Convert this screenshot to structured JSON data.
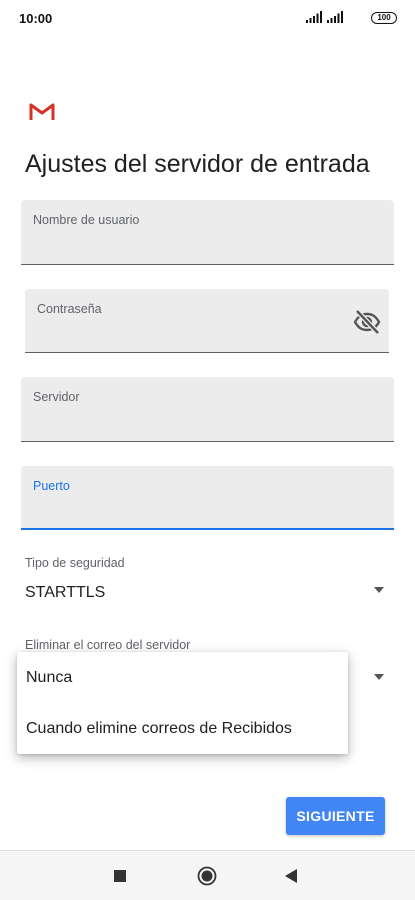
{
  "status_bar": {
    "time": "10:00",
    "battery": "100",
    "icons": [
      "signal-icon",
      "signal-icon",
      "battery-icon"
    ]
  },
  "app": {
    "logo_icon": "gmail-logo-icon",
    "brand_color": "#d93025"
  },
  "page": {
    "title": "Ajustes del servidor de entrada"
  },
  "form": {
    "username": {
      "label": "Nombre de usuario",
      "value": ""
    },
    "password": {
      "label": "Contraseña",
      "value": "",
      "toggle_icon": "visibility-off-icon"
    },
    "server": {
      "label": "Servidor",
      "value": ""
    },
    "port": {
      "label": "Puerto",
      "value": "",
      "focused": true
    },
    "security_type": {
      "label": "Tipo de seguridad",
      "value": "STARTTLS"
    },
    "delete_from_server": {
      "label": "Eliminar el correo del servidor"
    }
  },
  "dropdown_menu": {
    "options": [
      "Nunca",
      "Cuando elimine correos de Recibidos"
    ]
  },
  "actions": {
    "next_label": "SIGUIENTE"
  },
  "colors": {
    "accent": "#1a73e8",
    "button": "#4285f4",
    "field_bg": "#ececec"
  },
  "nav_bar": {
    "icons": [
      "recents-square-icon",
      "home-circle-icon",
      "back-triangle-icon"
    ]
  }
}
